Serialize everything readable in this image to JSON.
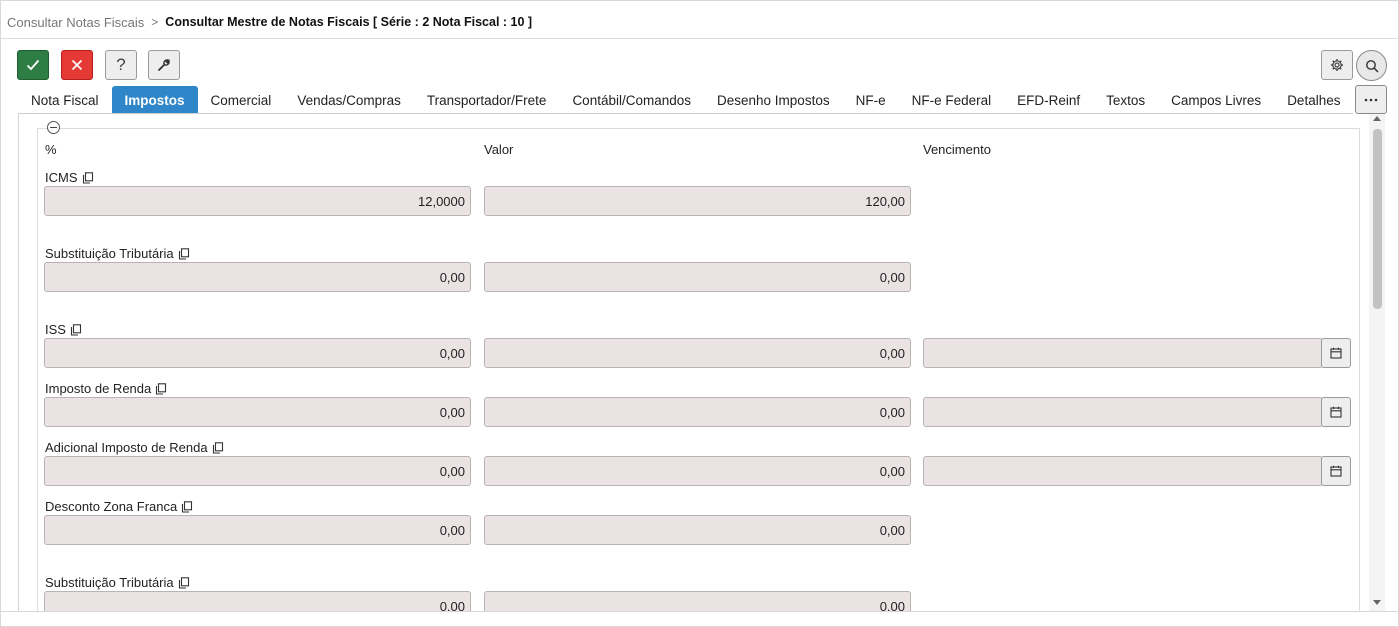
{
  "breadcrumb": {
    "previous": "Consultar Notas Fiscais",
    "separator": ">",
    "current": "Consultar Mestre de Notas Fiscais [ Série : 2 Nota Fiscal : 10 ]"
  },
  "toolbar": {
    "help_label": "?",
    "more_label": "···"
  },
  "colors": {
    "confirm": "#2e7d45",
    "cancel": "#e53935",
    "active_tab": "#2f86c9",
    "field_bg": "#ebe3e3"
  },
  "icons": [
    "check-icon",
    "close-icon",
    "question-icon",
    "wrench-icon",
    "gear-icon",
    "search-icon",
    "ellipsis-icon",
    "collapse-icon",
    "copy-icon",
    "calendar-icon"
  ],
  "tabs": [
    {
      "label": "Nota Fiscal"
    },
    {
      "label": "Impostos",
      "active": true
    },
    {
      "label": "Comercial"
    },
    {
      "label": "Vendas/Compras"
    },
    {
      "label": "Transportador/Frete"
    },
    {
      "label": "Contábil/Comandos"
    },
    {
      "label": "Desenho Impostos"
    },
    {
      "label": "NF-e"
    },
    {
      "label": "NF-e Federal"
    },
    {
      "label": "EFD-Reinf"
    },
    {
      "label": "Textos"
    },
    {
      "label": "Campos Livres"
    },
    {
      "label": "Detalhes"
    }
  ],
  "columns": {
    "percent": "%",
    "value": "Valor",
    "due": "Vencimento"
  },
  "fields": [
    {
      "label": "ICMS",
      "percent": "12,0000",
      "value": "120,00"
    },
    {
      "label": "Substituição Tributária",
      "percent": "0,00",
      "value": "0,00"
    },
    {
      "label": "ISS",
      "percent": "0,00",
      "value": "0,00",
      "due": ""
    },
    {
      "label": "Imposto de Renda",
      "percent": "0,00",
      "value": "0,00",
      "due": ""
    },
    {
      "label": "Adicional Imposto de Renda",
      "percent": "0,00",
      "value": "0,00",
      "due": ""
    },
    {
      "label": "Desconto Zona Franca",
      "percent": "0,00",
      "value": "0,00"
    },
    {
      "label": "Substituição Tributária",
      "percent": "0,00",
      "value": "0,00"
    }
  ]
}
